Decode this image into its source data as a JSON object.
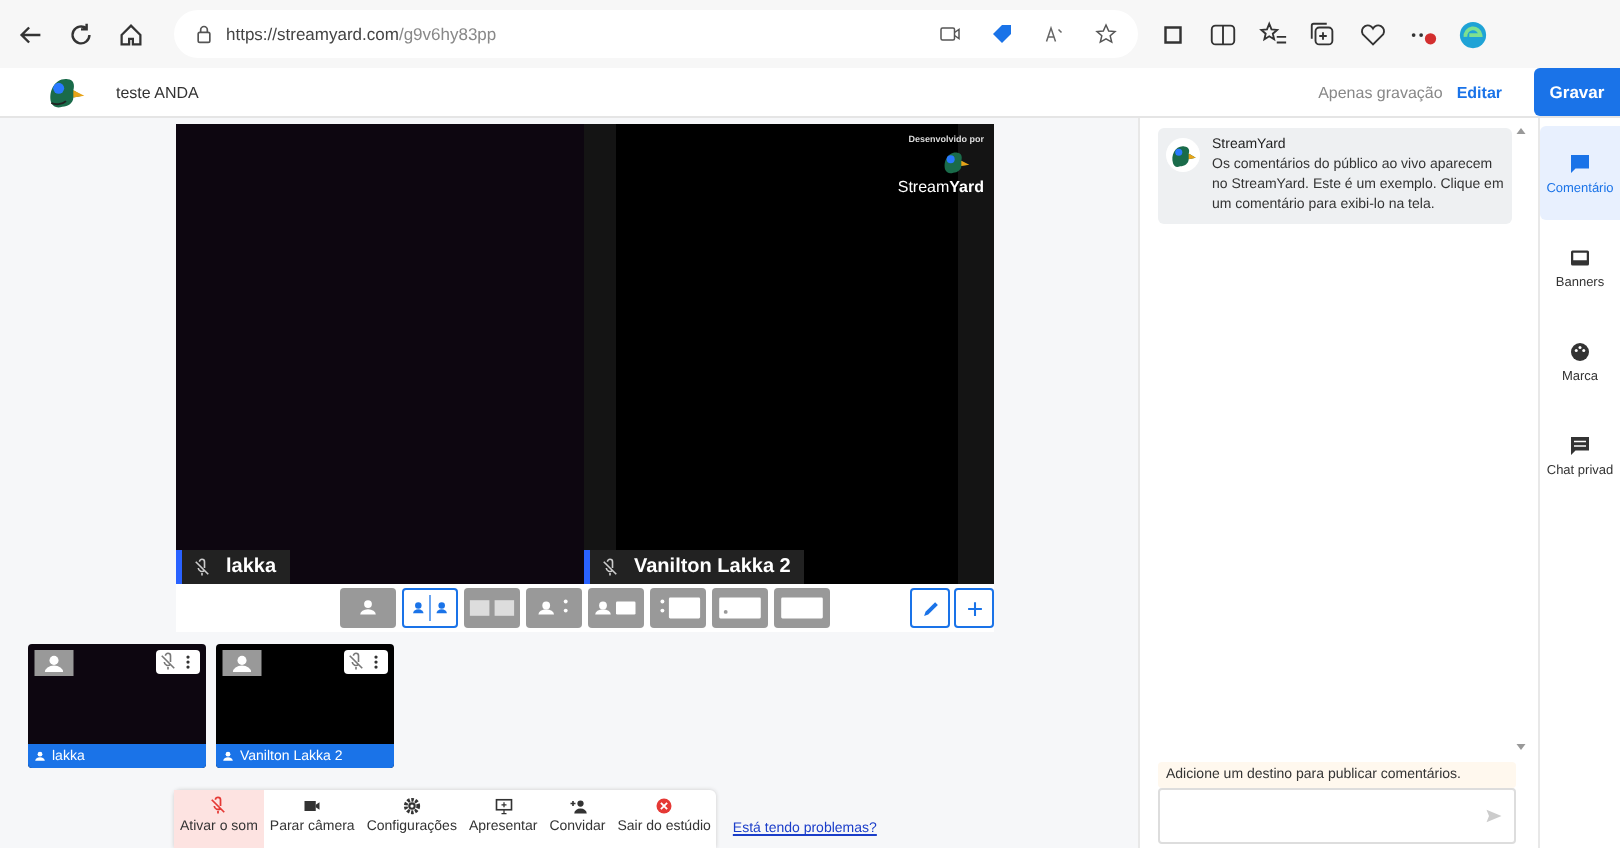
{
  "browser": {
    "url_host": "https://streamyard.com",
    "url_path": "/g9v6hy83pp"
  },
  "header": {
    "title": "teste ANDA",
    "mode": "Apenas gravação",
    "edit": "Editar",
    "record": "Gravar"
  },
  "stage": {
    "tiles": [
      {
        "name": "lakka",
        "muted": true,
        "kind": "dark"
      },
      {
        "name": "Vanilton Lakka 2",
        "muted": true,
        "kind": "black"
      }
    ],
    "branding": {
      "caption": "Desenvolvido por",
      "logo_a": "Stream",
      "logo_b": "Yard"
    }
  },
  "layouts": [
    {
      "kind": "solo",
      "selected": false
    },
    {
      "kind": "split",
      "selected": true
    },
    {
      "kind": "group",
      "selected": false
    },
    {
      "kind": "leader",
      "selected": false
    },
    {
      "kind": "cropped",
      "selected": false
    },
    {
      "kind": "sidebar",
      "selected": false
    },
    {
      "kind": "pip",
      "selected": false
    },
    {
      "kind": "screen",
      "selected": false
    }
  ],
  "participants": [
    {
      "name": "lakka",
      "kind": "dark"
    },
    {
      "name": "Vanilton Lakka 2",
      "kind": "black"
    }
  ],
  "controls": [
    {
      "kind": "mic",
      "label": "Ativar o som",
      "active": true
    },
    {
      "kind": "camera",
      "label": "Parar câmera",
      "active": false
    },
    {
      "kind": "gear",
      "label": "Configurações",
      "active": false
    },
    {
      "kind": "present",
      "label": "Apresentar",
      "active": false
    },
    {
      "kind": "invite",
      "label": "Convidar",
      "active": false
    },
    {
      "kind": "leave",
      "label": "Sair do estúdio",
      "active": false
    }
  ],
  "help_link": "Está tendo problemas?",
  "chat": {
    "message": {
      "author": "StreamYard",
      "text": "Os comentários do público ao vivo aparecem no StreamYard. Este é um exemplo. Clique em um comentário para exibi-lo na tela."
    },
    "notice": "Adicione um destino para publicar comentários."
  },
  "side_tabs": [
    {
      "kind": "comments",
      "label": "Comentário",
      "selected": true
    },
    {
      "kind": "banners",
      "label": "Banners",
      "selected": false
    },
    {
      "kind": "brand",
      "label": "Marca",
      "selected": false
    },
    {
      "kind": "private",
      "label": "Chat privad",
      "selected": false
    }
  ]
}
